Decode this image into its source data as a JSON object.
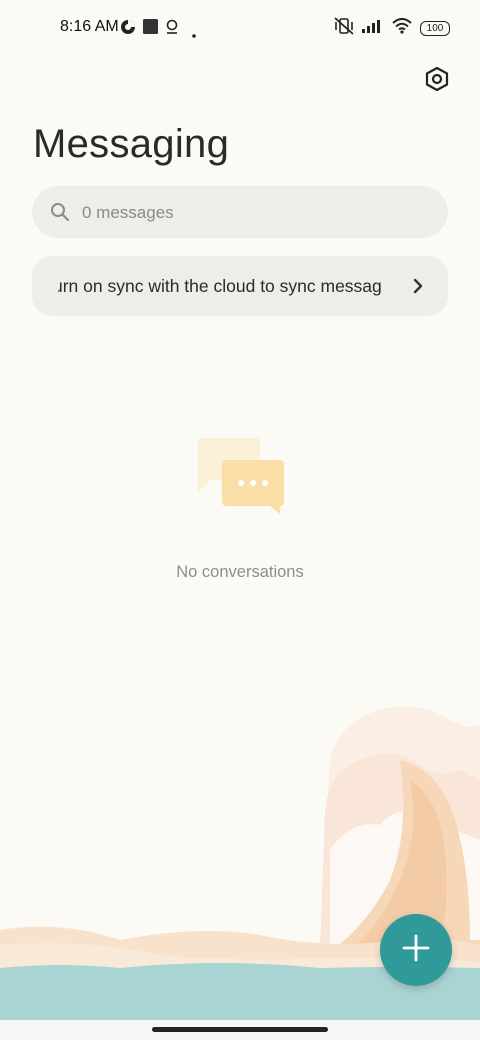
{
  "status_bar": {
    "time": "8:16 AM",
    "battery": "100",
    "icons": [
      "data-saver-icon",
      "stop-square-icon",
      "pin-icon",
      "dot-icon",
      "mute-vibrate-icon",
      "signal-icon",
      "wifi-icon",
      "battery-icon"
    ]
  },
  "header": {
    "title": "Messaging",
    "settings_icon": "settings-hexagon-icon"
  },
  "search": {
    "placeholder": "0 messages",
    "icon": "search-icon"
  },
  "sync_banner": {
    "text": "urn on sync with the cloud to sync messag",
    "icon": "chevron-right-icon"
  },
  "empty_state": {
    "icon": "chat-bubbles-icon",
    "text": "No conversations"
  },
  "fab": {
    "icon": "plus-icon",
    "color": "#2f9a98"
  },
  "colors": {
    "background": "#fcfaf4",
    "surface": "#efede8",
    "accent": "#2f9a98",
    "sea": "#a9d4d4"
  }
}
